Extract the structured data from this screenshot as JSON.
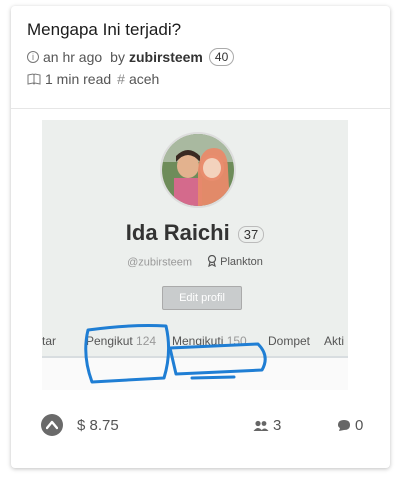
{
  "post": {
    "title": "Mengapa Ini terjadi?",
    "time": "an hr ago",
    "by": "by",
    "author": "zubirsteem",
    "reputation": "40",
    "read_time": "1 min read",
    "tag": "aceh"
  },
  "profile_image": {
    "name": "Ida Raichi",
    "reputation": "37",
    "handle": "@zubirsteem",
    "rank": "Plankton",
    "edit_label": "Edit profil",
    "tabs": [
      {
        "label": "tar",
        "count": ""
      },
      {
        "label": "Pengikut",
        "count": "124"
      },
      {
        "label": "Mengikuti",
        "count": "150"
      },
      {
        "label": "Dompet",
        "count": ""
      },
      {
        "label": "Akti",
        "count": ""
      }
    ]
  },
  "footer": {
    "payout": "8.75",
    "voters": "3",
    "comments": "0"
  },
  "colors": {
    "annotation_ink": "#1f7ed4",
    "vote_button": "#6a6a6a"
  }
}
